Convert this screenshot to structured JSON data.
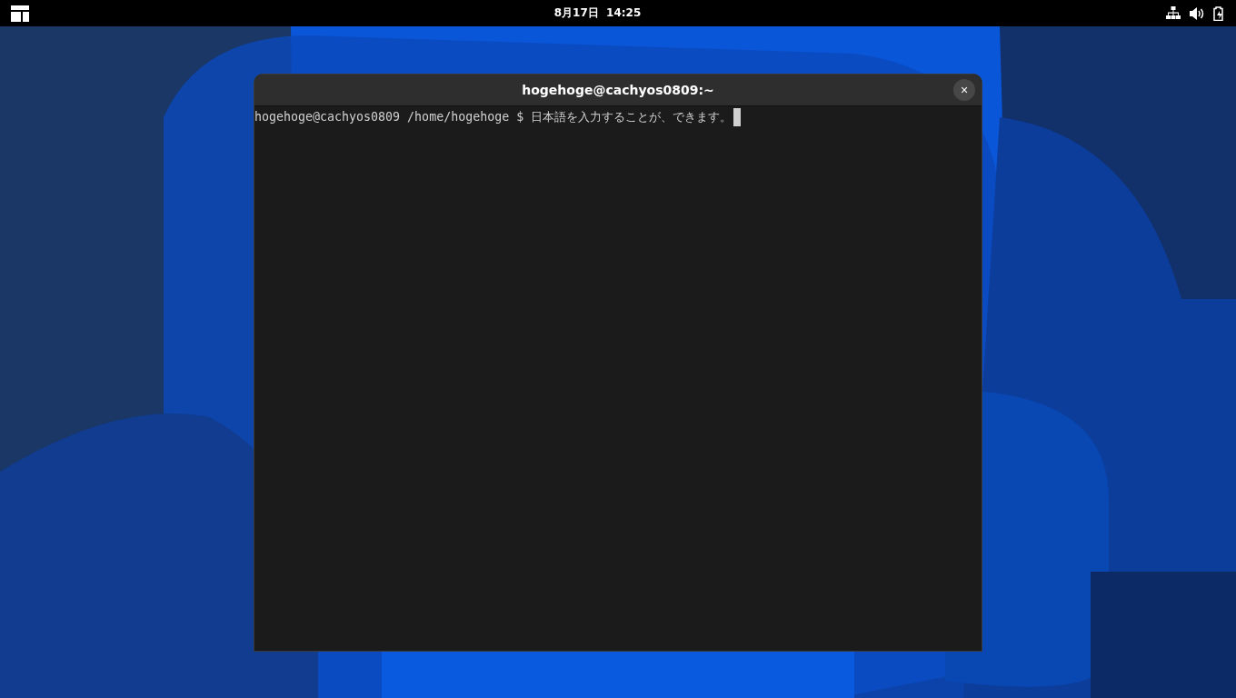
{
  "top_bar": {
    "clock": "8月17日  14:25"
  },
  "terminal": {
    "title": "hogehoge@cachyos0809:~",
    "close": "×",
    "lines": [
      {
        "prompt": "hogehoge@cachyos0809 /home/hogehoge $ ",
        "input": "日本語を入力することが、できます。",
        "cursor": true
      }
    ]
  }
}
